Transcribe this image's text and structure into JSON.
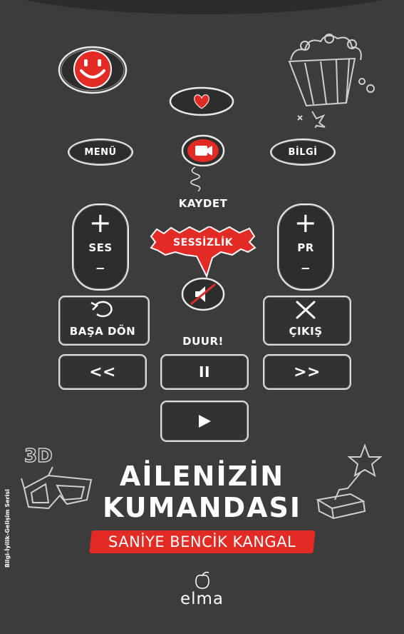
{
  "book": {
    "title_line1": "AİLENİZİN",
    "title_line2": "KUMANDASI",
    "author": "SANİYE BENCİK KANGAL",
    "series": "Bilgi-İyilik-Gelişim Serisi",
    "publisher": "elma"
  },
  "remote": {
    "menu_label": "MENÜ",
    "info_label": "BİLGİ",
    "record_label": "KAYDET",
    "mute_label": "SESSİZLİK",
    "volume_label": "SES",
    "channel_label": "PR",
    "plus_symbol": "+",
    "minus_symbol": "–",
    "restart_label": "BAŞA DÖN",
    "exit_label": "ÇIKIŞ",
    "stop_label": "DUUR!",
    "rewind_label": "<<",
    "forward_label": ">>",
    "pause_label": "II"
  },
  "doodles": {
    "three_d_label": "3D"
  },
  "icons": [
    "smiley-icon",
    "heart-icon",
    "camera-icon",
    "mute-icon",
    "restart-arrow-icon",
    "close-x-icon",
    "play-icon",
    "popcorn-icon",
    "trophy-icon",
    "3d-glasses-icon",
    "star-icon",
    "apple-logo-icon"
  ],
  "colors": {
    "background": "#3d3c3c",
    "accent_red": "#e32b26",
    "chalk_white": "#e8e8e8"
  }
}
